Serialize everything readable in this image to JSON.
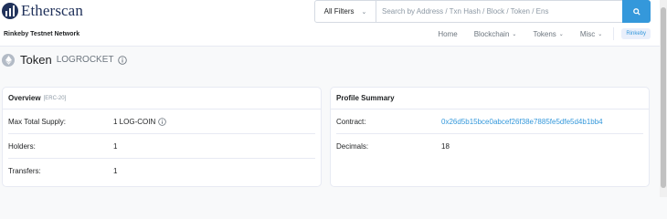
{
  "header": {
    "logo_text": "Etherscan",
    "network_label": "Rinkeby Testnet Network",
    "search": {
      "filter_label": "All Filters",
      "placeholder": "Search by Address / Txn Hash / Block / Token / Ens"
    },
    "nav": {
      "home": "Home",
      "blockchain": "Blockchain",
      "tokens": "Tokens",
      "misc": "Misc",
      "network_button": "Rinkeby"
    }
  },
  "token": {
    "word": "Token",
    "name": "LOGROCKET"
  },
  "overview": {
    "title": "Overview",
    "standard": "[ERC-20]",
    "rows": [
      {
        "label": "Max Total Supply:",
        "value": "1 LOG-COIN"
      },
      {
        "label": "Holders:",
        "value": "1"
      },
      {
        "label": "Transfers:",
        "value": "1"
      }
    ]
  },
  "profile": {
    "title": "Profile Summary",
    "rows": [
      {
        "label": "Contract:",
        "value": "0x26d5b15bce0abcef26f38e7885fe5dfe5d4b1bb4"
      },
      {
        "label": "Decimals:",
        "value": "18"
      }
    ]
  },
  "colors": {
    "brand": "#21325b",
    "accent": "#3498db",
    "background": "#f8f9fa"
  },
  "icons": [
    "etherscan-logo-icon",
    "chevron-down-icon",
    "search-icon",
    "ethereum-token-icon",
    "info-icon"
  ]
}
